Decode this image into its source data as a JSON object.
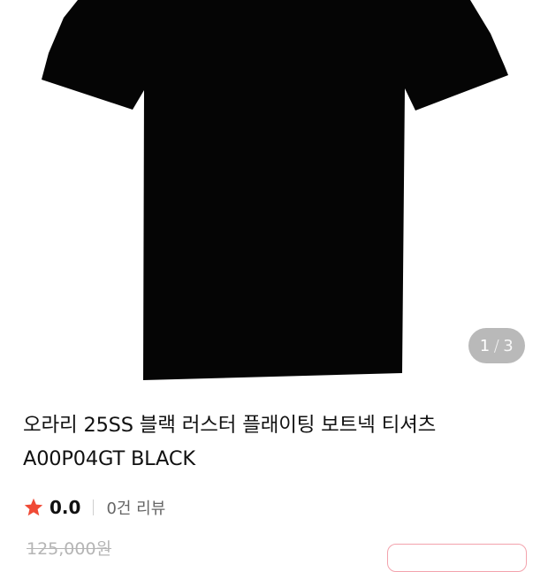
{
  "product": {
    "title_line1": "오라리 25SS 블랙 러스터 플래이팅 보트넥 티셔츠",
    "title_line2": "A00P04GT BLACK",
    "rating_score": "0.0",
    "review_count": "0건 리뷰",
    "original_price": "125,000원"
  },
  "gallery": {
    "current": "1",
    "separator": "/",
    "total": "3",
    "image_alt": "black t-shirt"
  },
  "icons": {
    "rating": "star-icon"
  },
  "colors": {
    "star": "#f04a36",
    "shirt": "#050505",
    "badge_border": "#f3a3ad"
  }
}
